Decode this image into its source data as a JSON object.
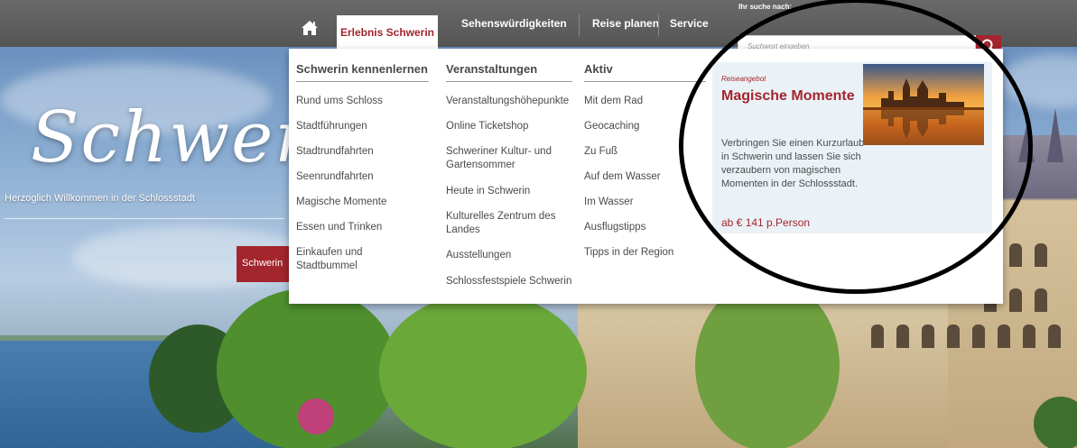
{
  "colors": {
    "brand_red": "#a3252d",
    "nav_bg": "#5f5f5f",
    "menu_text": "#4a4a4a",
    "promo_bg": "#eaf2f7",
    "annotation_outline": "#000000"
  },
  "nav": {
    "home_icon": "home-icon",
    "items": [
      "Erlebnis Schwerin",
      "Sehenswürdigkeiten",
      "Reise planen",
      "Service"
    ],
    "active": "Erlebnis Schwerin"
  },
  "search": {
    "label": "Ihr suche nach:",
    "placeholder": "Suchwort eingeben",
    "icon": "search-icon"
  },
  "hero": {
    "title": "Schweri",
    "subtitle": "Herzoglich Willkommen in der Schlossstadt",
    "badge": "Schwerin"
  },
  "menu": {
    "columns": [
      {
        "title": "Schwerin kennenlernen",
        "links": [
          "Rund ums Schloss",
          "Stadtführungen",
          "Stadtrundfahrten",
          "Seenrundfahrten",
          "Magische Momente",
          "Essen und Trinken",
          "Einkaufen und Stadtbummel"
        ]
      },
      {
        "title": "Veranstaltungen",
        "links": [
          "Veranstaltungshöhepunkte",
          "Online Ticketshop",
          "Schweriner Kultur- und Gartensommer",
          "Heute in Schwerin",
          "Kulturelles Zentrum des Landes",
          "Ausstellungen",
          "Schlossfestspiele Schwerin"
        ]
      },
      {
        "title": "Aktiv",
        "links": [
          "Mit dem Rad",
          "Geocaching",
          "Zu Fuß",
          "Auf dem Wasser",
          "Im Wasser",
          "Ausflugstipps",
          "Tipps in der Region"
        ]
      }
    ],
    "promo": {
      "kicker": "Reiseangebot",
      "title": "Magische Momente",
      "text": "Verbringen Sie einen Kurzurlaub in Schwerin und lassen Sie sich verzaubern von magischen Momenten in der Schlossstadt.",
      "price": "ab € 141 p.Person"
    }
  }
}
